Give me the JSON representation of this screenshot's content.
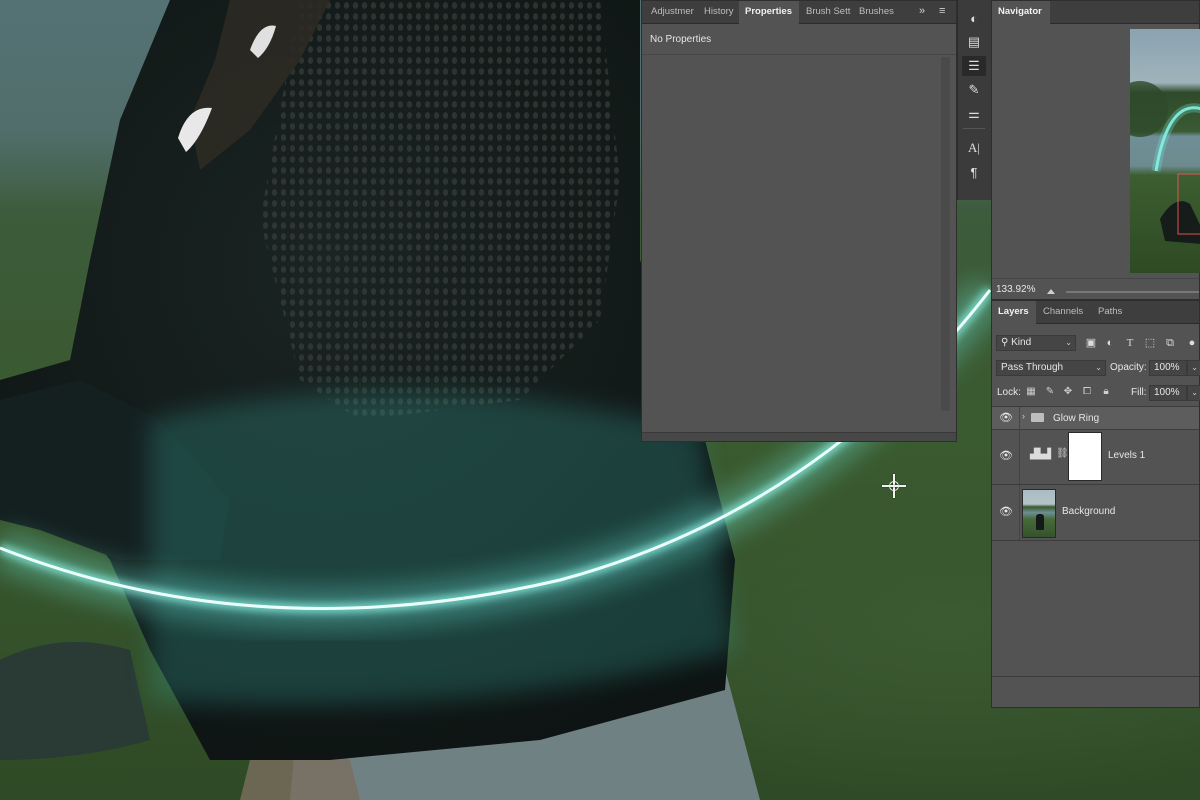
{
  "properties_panel": {
    "tabs": [
      "Adjustmer",
      "History",
      "Properties",
      "Brush Sett",
      "Brushes"
    ],
    "active_tab": "Properties",
    "overflow_icon": "double-chevron-right-icon",
    "menu_icon": "panel-menu-icon",
    "content_title": "No Properties"
  },
  "tool_strip": {
    "icons": [
      "adjustments-icon",
      "history-icon",
      "properties-icon",
      "brush-settings-icon",
      "brushes-icon",
      "tool-presets-icon",
      "character-icon",
      "paragraph-icon"
    ],
    "selected": "properties-icon"
  },
  "navigator": {
    "tab": "Navigator",
    "zoom": "133.92%"
  },
  "layers_panel": {
    "tabs": [
      "Layers",
      "Channels",
      "Paths"
    ],
    "active_tab": "Layers",
    "filter_kind": "Kind",
    "blend_mode": "Pass Through",
    "opacity_label": "Opacity:",
    "opacity_value": "100%",
    "lock_label": "Lock:",
    "fill_label": "Fill:",
    "fill_value": "100%",
    "layers": [
      {
        "name": "Glow Ring",
        "type": "group"
      },
      {
        "name": "Levels 1",
        "type": "adjustment"
      },
      {
        "name": "Background",
        "type": "image"
      }
    ]
  },
  "colors": {
    "glow": "#7ff3e6",
    "panel_bg": "#535353",
    "tabbar_bg": "#3e3e3e"
  }
}
